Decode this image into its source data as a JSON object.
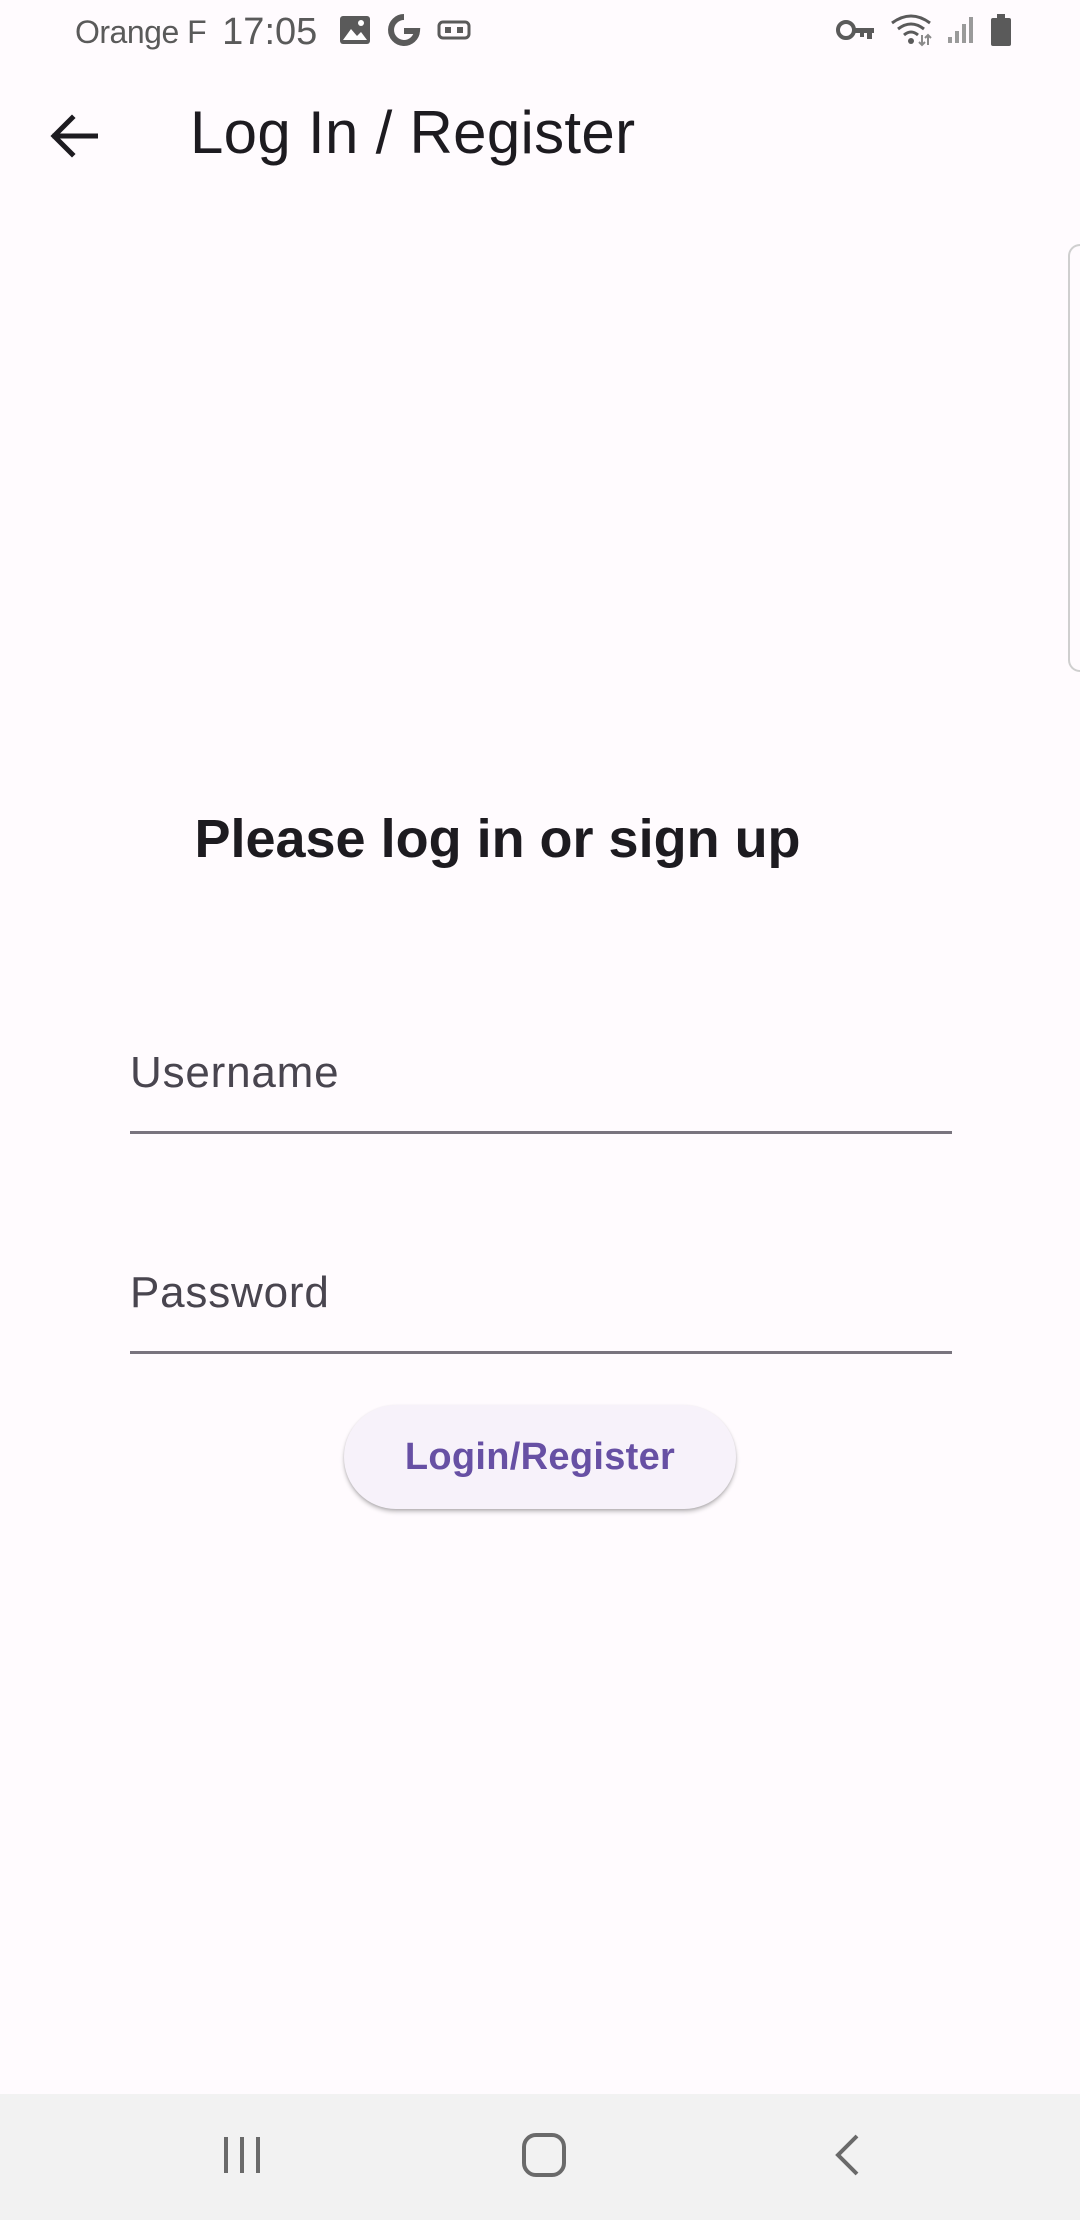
{
  "status_bar": {
    "carrier": "Orange F",
    "time": "17:05",
    "left_icons": [
      "gallery-icon",
      "google-icon",
      "vr-headset-icon"
    ],
    "right_icons": [
      "vpn-key-icon",
      "wifi-icon",
      "signal-icon",
      "battery-icon"
    ]
  },
  "app_bar": {
    "title": "Log In / Register",
    "back_icon": "arrow-back-icon"
  },
  "content": {
    "heading": "Please log in or sign up",
    "username": {
      "placeholder": "Username",
      "value": ""
    },
    "password": {
      "placeholder": "Password",
      "value": ""
    },
    "login_button_label": "Login/Register"
  },
  "nav_bar": {
    "icons": [
      "recents-icon",
      "home-icon",
      "back-icon"
    ]
  },
  "colors": {
    "background": "#fffbfe",
    "accent": "#6750a4",
    "button_surface": "#f7f2fa",
    "field_underline": "#79747e",
    "text_primary": "#1d1b20",
    "nav_bar": "#f2f2f2"
  }
}
